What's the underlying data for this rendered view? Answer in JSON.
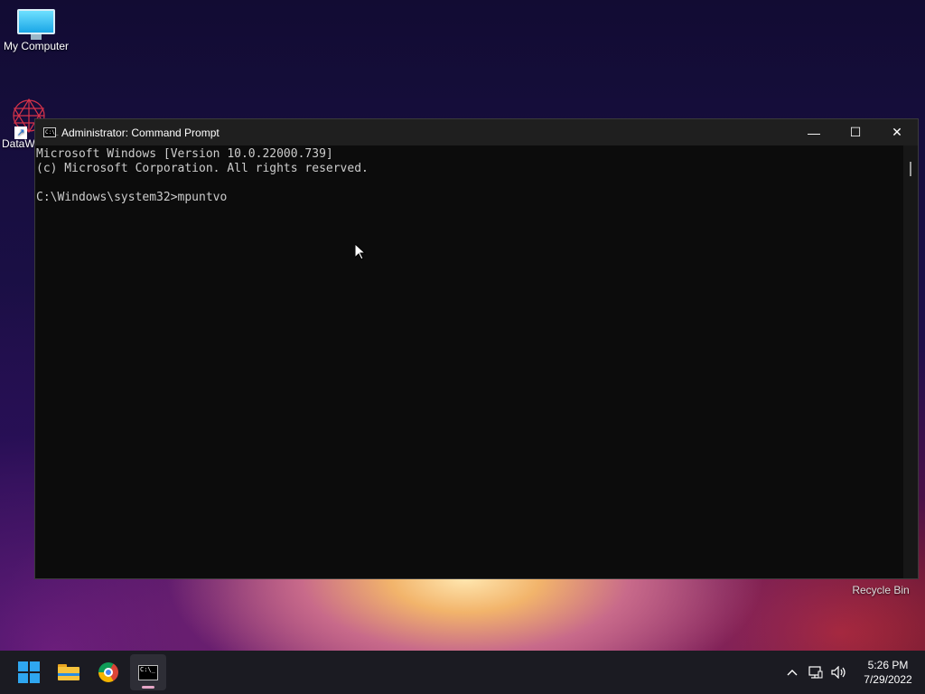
{
  "desktop": {
    "icons": [
      {
        "label": "My Computer"
      },
      {
        "label": "DataW"
      }
    ],
    "recycle_bin_label": "Recycle Bin"
  },
  "window": {
    "title": "Administrator: Command Prompt",
    "icon_glyph": "C:\\_",
    "controls": {
      "minimize": "—",
      "maximize": "☐",
      "close": "✕"
    },
    "console_lines": [
      "Microsoft Windows [Version 10.0.22000.739]",
      "(c) Microsoft Corporation. All rights reserved.",
      "",
      "C:\\Windows\\system32>mpuntvo"
    ]
  },
  "taskbar": {
    "apps": [
      {
        "name": "start",
        "icon": "windows-logo-icon"
      },
      {
        "name": "file-explorer",
        "icon": "folder-icon"
      },
      {
        "name": "chrome",
        "icon": "chrome-icon"
      },
      {
        "name": "command-prompt",
        "icon": "cmd-icon",
        "active": true
      }
    ],
    "cmd_icon_glyph": "C:\\_",
    "tray": {
      "chevron": "^",
      "network": "🖧",
      "volume": "🔊"
    },
    "clock": {
      "time": "5:26 PM",
      "date": "7/29/2022"
    }
  },
  "colors": {
    "console_bg": "#0c0c0c",
    "console_text": "#cccccc",
    "titlebar": "#1f1f1f",
    "taskbar": "#1b1b22"
  }
}
